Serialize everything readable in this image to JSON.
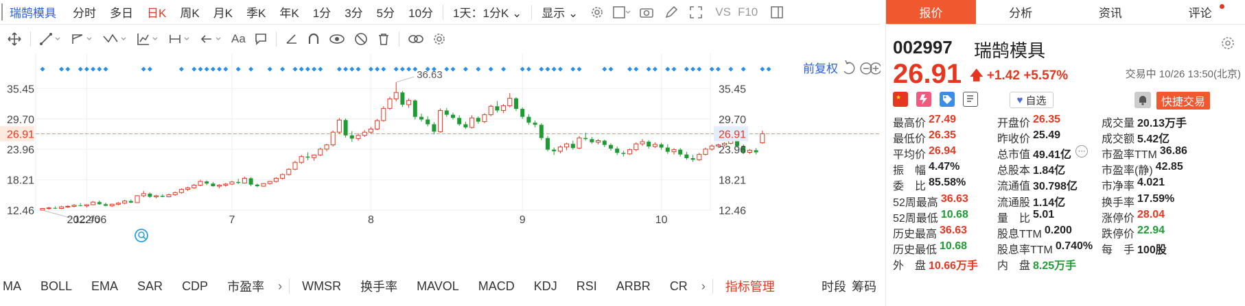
{
  "toolbar": {
    "stock_name": "瑞鹄模具",
    "periods": [
      "分时",
      "多日",
      "日K",
      "周K",
      "月K",
      "季K",
      "年K",
      "1分",
      "3分",
      "5分",
      "10分",
      "1天：1分K"
    ],
    "active_period": "日K",
    "display_label": "显示",
    "vs_label": "VS",
    "f10_label": "F10"
  },
  "chart": {
    "adjust_label": "前复权",
    "current_price": "26.91",
    "y_ticks": [
      "35.45",
      "29.70",
      "23.96",
      "18.21",
      "12.46"
    ],
    "x_ticks": [
      "2022/06",
      "7",
      "8",
      "9",
      "10"
    ],
    "high_annotation": "36.63",
    "low_annotation": "12.46"
  },
  "chart_data": {
    "type": "candlestick",
    "ylim": [
      9.5,
      39.5
    ],
    "current": 26.91,
    "high": 36.63,
    "low": 12.46,
    "ohlc": [
      [
        12.5,
        12.9,
        12.4,
        12.8
      ],
      [
        12.8,
        13.1,
        12.6,
        12.9
      ],
      [
        12.9,
        13.2,
        12.7,
        12.8
      ],
      [
        12.8,
        13.3,
        12.7,
        13.1
      ],
      [
        13.1,
        13.4,
        12.9,
        13.2
      ],
      [
        13.2,
        13.6,
        13.0,
        13.4
      ],
      [
        13.4,
        13.8,
        13.2,
        13.3
      ],
      [
        13.3,
        13.6,
        13.0,
        13.5
      ],
      [
        13.5,
        14.2,
        13.4,
        14.0
      ],
      [
        14.0,
        14.3,
        13.5,
        13.6
      ],
      [
        13.6,
        13.9,
        13.2,
        13.3
      ],
      [
        13.3,
        13.7,
        13.1,
        13.6
      ],
      [
        13.6,
        14.0,
        13.4,
        13.8
      ],
      [
        13.8,
        14.4,
        13.6,
        14.2
      ],
      [
        14.2,
        14.5,
        13.8,
        13.9
      ],
      [
        13.9,
        15.3,
        13.9,
        15.2
      ],
      [
        15.2,
        16.1,
        14.9,
        15.6
      ],
      [
        15.6,
        15.8,
        14.8,
        15.0
      ],
      [
        15.0,
        15.4,
        14.7,
        15.2
      ],
      [
        15.2,
        15.5,
        14.9,
        15.0
      ],
      [
        15.0,
        15.6,
        14.9,
        15.4
      ],
      [
        15.4,
        16.0,
        15.2,
        15.8
      ],
      [
        15.8,
        16.6,
        15.6,
        16.4
      ],
      [
        16.4,
        16.9,
        16.1,
        16.7
      ],
      [
        16.7,
        17.4,
        16.5,
        17.2
      ],
      [
        17.2,
        18.2,
        17.0,
        17.9
      ],
      [
        17.9,
        18.1,
        17.2,
        17.5
      ],
      [
        17.5,
        17.8,
        16.9,
        17.0
      ],
      [
        17.0,
        17.4,
        16.6,
        17.2
      ],
      [
        17.2,
        17.6,
        16.9,
        17.4
      ],
      [
        17.4,
        18.0,
        17.2,
        17.8
      ],
      [
        17.8,
        18.4,
        17.4,
        17.6
      ],
      [
        17.6,
        18.8,
        17.5,
        18.5
      ],
      [
        18.5,
        18.7,
        17.0,
        17.3
      ],
      [
        17.3,
        17.5,
        16.8,
        17.0
      ],
      [
        17.0,
        17.6,
        16.9,
        17.5
      ],
      [
        17.5,
        18.0,
        17.3,
        17.9
      ],
      [
        17.9,
        18.7,
        17.7,
        18.5
      ],
      [
        18.5,
        19.4,
        18.3,
        19.2
      ],
      [
        19.2,
        20.4,
        19.0,
        20.2
      ],
      [
        20.2,
        21.8,
        20.0,
        21.5
      ],
      [
        21.5,
        22.9,
        21.2,
        22.6
      ],
      [
        22.6,
        23.4,
        21.9,
        22.4
      ],
      [
        22.4,
        23.0,
        21.8,
        22.9
      ],
      [
        22.9,
        24.3,
        22.7,
        24.0
      ],
      [
        24.0,
        25.0,
        23.6,
        24.8
      ],
      [
        24.8,
        27.5,
        24.5,
        27.2
      ],
      [
        27.2,
        29.9,
        26.9,
        29.5
      ],
      [
        29.5,
        29.8,
        26.2,
        26.6
      ],
      [
        26.6,
        27.4,
        25.4,
        26.0
      ],
      [
        26.0,
        27.0,
        25.6,
        26.6
      ],
      [
        26.6,
        27.6,
        26.3,
        27.2
      ],
      [
        27.2,
        28.2,
        26.9,
        27.8
      ],
      [
        27.8,
        29.7,
        27.6,
        29.4
      ],
      [
        29.4,
        32.1,
        29.2,
        31.7
      ],
      [
        31.7,
        33.9,
        31.4,
        33.5
      ],
      [
        33.5,
        36.63,
        33.0,
        34.7
      ],
      [
        34.7,
        35.0,
        32.0,
        32.4
      ],
      [
        32.4,
        33.6,
        31.8,
        33.2
      ],
      [
        33.2,
        33.4,
        29.6,
        30.1
      ],
      [
        30.1,
        30.7,
        29.2,
        29.6
      ],
      [
        29.6,
        30.2,
        28.3,
        28.7
      ],
      [
        28.7,
        29.1,
        26.8,
        27.3
      ],
      [
        27.3,
        31.7,
        27.1,
        31.3
      ],
      [
        31.3,
        31.8,
        30.1,
        30.5
      ],
      [
        30.5,
        30.9,
        29.6,
        29.9
      ],
      [
        29.9,
        30.4,
        28.4,
        28.7
      ],
      [
        28.7,
        29.2,
        27.8,
        28.1
      ],
      [
        28.1,
        30.4,
        27.9,
        29.9
      ],
      [
        29.9,
        30.2,
        28.8,
        29.2
      ],
      [
        29.2,
        30.8,
        28.9,
        30.5
      ],
      [
        30.5,
        32.4,
        30.2,
        32.1
      ],
      [
        32.1,
        33.1,
        30.9,
        31.3
      ],
      [
        31.3,
        32.5,
        30.8,
        32.2
      ],
      [
        32.2,
        34.6,
        31.9,
        33.6
      ],
      [
        33.6,
        33.8,
        31.2,
        31.6
      ],
      [
        31.6,
        31.9,
        29.7,
        30.1
      ],
      [
        30.1,
        30.6,
        28.6,
        29.0
      ],
      [
        29.0,
        29.4,
        28.1,
        28.6
      ],
      [
        28.6,
        28.9,
        25.7,
        26.1
      ],
      [
        26.1,
        26.5,
        23.6,
        23.9
      ],
      [
        23.9,
        24.3,
        22.9,
        23.6
      ],
      [
        23.6,
        24.7,
        23.2,
        24.4
      ],
      [
        24.4,
        25.2,
        23.8,
        25.0
      ],
      [
        25.0,
        25.6,
        23.9,
        24.2
      ],
      [
        24.2,
        26.5,
        24.0,
        26.1
      ],
      [
        26.1,
        27.1,
        25.6,
        25.9
      ],
      [
        25.9,
        26.3,
        25.0,
        25.3
      ],
      [
        25.3,
        25.9,
        24.9,
        25.6
      ],
      [
        25.6,
        25.8,
        24.4,
        24.8
      ],
      [
        24.8,
        25.1,
        23.7,
        24.1
      ],
      [
        24.1,
        24.5,
        22.9,
        23.3
      ],
      [
        23.3,
        23.7,
        22.6,
        23.1
      ],
      [
        23.1,
        24.1,
        22.9,
        23.9
      ],
      [
        23.9,
        25.3,
        23.6,
        25.0
      ],
      [
        25.0,
        25.9,
        24.6,
        25.4
      ],
      [
        25.4,
        25.7,
        24.1,
        24.5
      ],
      [
        24.5,
        25.3,
        24.2,
        24.9
      ],
      [
        24.9,
        25.2,
        23.9,
        24.3
      ],
      [
        24.3,
        24.9,
        23.1,
        23.5
      ],
      [
        23.5,
        24.2,
        23.0,
        23.9
      ],
      [
        23.9,
        24.2,
        22.6,
        23.0
      ],
      [
        23.0,
        23.5,
        22.0,
        22.3
      ],
      [
        22.3,
        22.9,
        21.6,
        22.0
      ],
      [
        22.0,
        23.3,
        21.8,
        23.0
      ],
      [
        23.0,
        24.3,
        22.8,
        24.0
      ],
      [
        24.0,
        24.9,
        23.7,
        24.6
      ],
      [
        24.6,
        25.0,
        24.2,
        24.8
      ],
      [
        24.8,
        25.3,
        24.5,
        25.1
      ],
      [
        25.1,
        26.0,
        24.9,
        25.7
      ],
      [
        25.7,
        25.9,
        24.2,
        24.6
      ],
      [
        24.6,
        24.9,
        23.1,
        23.4
      ],
      [
        23.4,
        24.0,
        23.1,
        23.8
      ],
      [
        23.8,
        24.2,
        23.0,
        23.4
      ],
      [
        25.2,
        27.5,
        25.0,
        26.91
      ]
    ]
  },
  "indicators": [
    "MA",
    "BOLL",
    "EMA",
    "SAR",
    "CDP",
    "市盈率",
    "WMSR",
    "换手率",
    "MAVOL",
    "MACD",
    "KDJ",
    "RSI",
    "ARBR",
    "CR"
  ],
  "indicator_manage": "指标管理",
  "bottom_right": [
    "时段",
    "筹码"
  ],
  "panel": {
    "tabs": [
      "报价",
      "分析",
      "资讯",
      "评论"
    ],
    "active_tab": "报价",
    "code": "002997",
    "name": "瑞鹄模具",
    "price": "26.91",
    "change": "+1.42",
    "change_pct": "+5.57%",
    "status": "交易中 10/26 13:50(北京)",
    "fav_label": "自选",
    "quick_trade": "快捷交易",
    "stats": [
      [
        {
          "label": "最高价",
          "value": "27.49",
          "c": "up"
        },
        {
          "label": "开盘价",
          "value": "26.35",
          "c": "up"
        },
        {
          "label": "成交量",
          "value": "20.13万手",
          "c": "nt"
        }
      ],
      [
        {
          "label": "最低价",
          "value": "26.35",
          "c": "up"
        },
        {
          "label": "昨收价",
          "value": "25.49",
          "c": "nt"
        },
        {
          "label": "成交额",
          "value": "5.42亿",
          "c": "nt"
        }
      ],
      [
        {
          "label": "平均价",
          "value": "26.94",
          "c": "up"
        },
        {
          "label": "总市值",
          "value": "49.41亿",
          "c": "nt"
        },
        {
          "label": "市盈率TTM",
          "value": "36.86",
          "c": "nt"
        }
      ],
      [
        {
          "label": "振　幅",
          "value": "4.47%",
          "c": "nt"
        },
        {
          "label": "总股本",
          "value": "1.84亿",
          "c": "nt"
        },
        {
          "label": "市盈率(静)",
          "value": "42.85",
          "c": "nt"
        }
      ],
      [
        {
          "label": "委　比",
          "value": "85.58%",
          "c": "nt"
        },
        {
          "label": "流通值",
          "value": "30.798亿",
          "c": "nt"
        },
        {
          "label": "市净率",
          "value": "4.021",
          "c": "nt"
        }
      ],
      [
        {
          "label": "52周最高",
          "value": "36.63",
          "c": "up"
        },
        {
          "label": "流通股",
          "value": "1.14亿",
          "c": "nt"
        },
        {
          "label": "换手率",
          "value": "17.59%",
          "c": "nt"
        }
      ],
      [
        {
          "label": "52周最低",
          "value": "10.68",
          "c": "dn"
        },
        {
          "label": "量　比",
          "value": "5.01",
          "c": "nt"
        },
        {
          "label": "涨停价",
          "value": "28.04",
          "c": "up"
        }
      ],
      [
        {
          "label": "历史最高",
          "value": "36.63",
          "c": "up"
        },
        {
          "label": "股息TTM",
          "value": "0.200",
          "c": "nt"
        },
        {
          "label": "跌停价",
          "value": "22.94",
          "c": "dn"
        }
      ],
      [
        {
          "label": "历史最低",
          "value": "10.68",
          "c": "dn"
        },
        {
          "label": "股息率TTM",
          "value": "0.740%",
          "c": "nt"
        },
        {
          "label": "每　手",
          "value": "100股",
          "c": "nt"
        }
      ],
      [
        {
          "label": "外　盘",
          "value": "10.66万手",
          "c": "up"
        },
        {
          "label": "内　盘",
          "value": "8.25万手",
          "c": "dn"
        }
      ]
    ]
  }
}
